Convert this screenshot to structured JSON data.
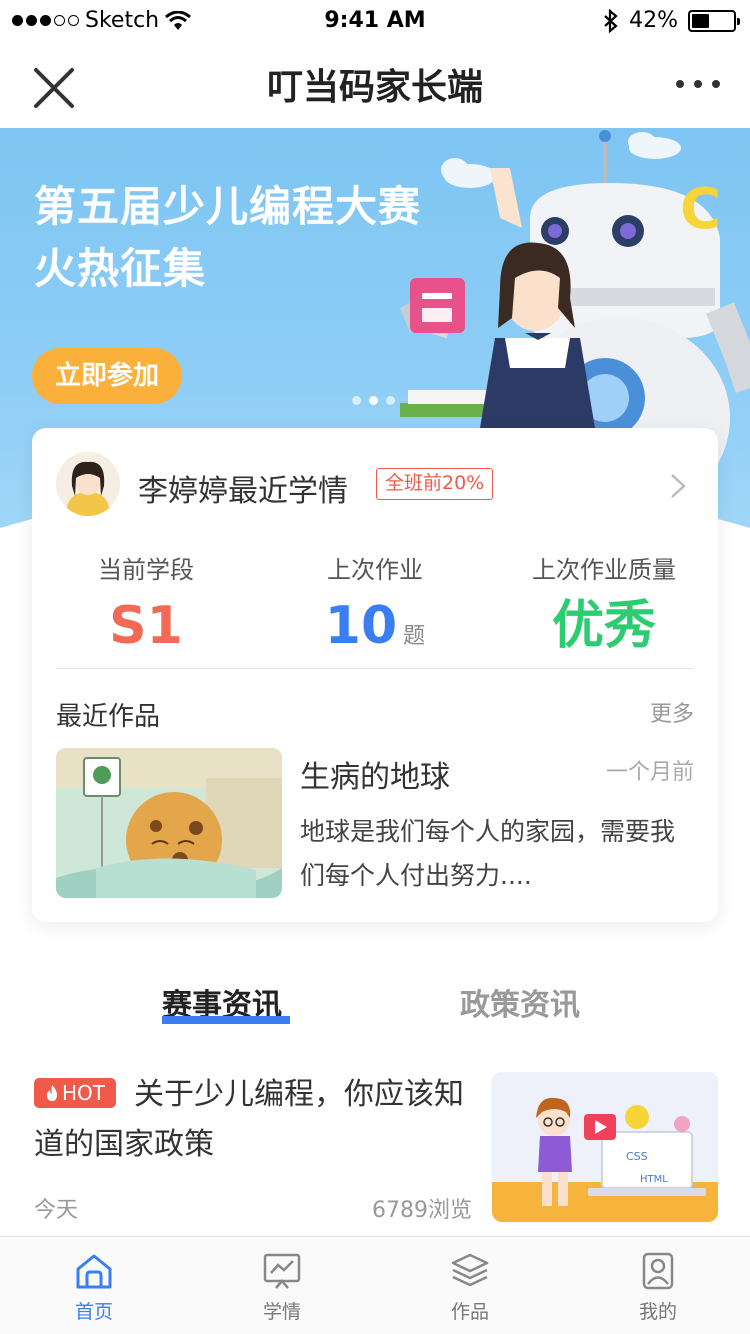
{
  "status_bar": {
    "carrier": "Sketch",
    "time": "9:41 AM",
    "battery": "42%",
    "battery_level": 0.42
  },
  "nav": {
    "title": "叮当码家长端"
  },
  "banner": {
    "title_line1": "第五届少儿编程大赛",
    "title_line2": "火热征集",
    "button": "立即参加",
    "art_letter": "C",
    "page_count": 3,
    "active_page": 1
  },
  "student": {
    "name": "李婷婷最近学情",
    "rank_badge": "全班前20%"
  },
  "stats": [
    {
      "label": "当前学段",
      "value": "S1",
      "unit": "",
      "color": "#f26a55"
    },
    {
      "label": "上次作业",
      "value": "10",
      "unit": "题",
      "color": "#3a7ef2"
    },
    {
      "label": "上次作业质量",
      "value": "优秀",
      "unit": "",
      "color": "#2ecc71"
    }
  ],
  "works": {
    "title": "最近作品",
    "more": "更多",
    "item": {
      "title": "生病的地球",
      "time": "一个月前",
      "desc": "地球是我们每个人的家园，需要我们每个人付出努力...."
    }
  },
  "tabs": {
    "active": "赛事资讯",
    "inactive": "政策资讯"
  },
  "news": {
    "badge": "HOT",
    "title": "关于少儿编程，你应该知道的国家政策",
    "date": "今天",
    "views": "6789浏览",
    "thumb_labels": [
      "CSS",
      "HTML"
    ]
  },
  "tab_bar": [
    {
      "label": "首页",
      "icon": "home-icon",
      "active": true
    },
    {
      "label": "学情",
      "icon": "chart-icon",
      "active": false
    },
    {
      "label": "作品",
      "icon": "layers-icon",
      "active": false
    },
    {
      "label": "我的",
      "icon": "profile-icon",
      "active": false
    }
  ],
  "colors": {
    "accent": "#3a7ef2",
    "banner_button": "#fbb03b",
    "hot": "#f05a4a"
  }
}
